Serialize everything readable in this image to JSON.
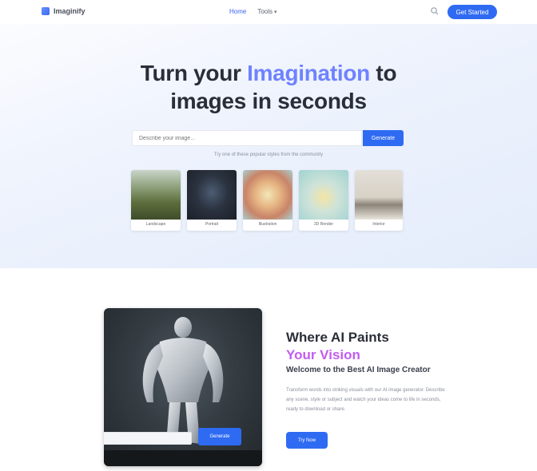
{
  "nav": {
    "logo_text": "Imaginify",
    "links": [
      {
        "label": "Home",
        "active": true
      },
      {
        "label": "Tools",
        "has_dropdown": true
      }
    ],
    "signup_label": "Get Started"
  },
  "hero": {
    "title_part1": "Turn your ",
    "title_accent": "Imagination",
    "title_part2": " to",
    "title_line2": "images in seconds",
    "prompt_placeholder": "Describe your image...",
    "generate_label": "Generate",
    "hint": "Try one of these popular styles from the community",
    "gallery": [
      {
        "label": "Landscape"
      },
      {
        "label": "Portrait"
      },
      {
        "label": "Illustration"
      },
      {
        "label": "3D Render"
      },
      {
        "label": "Interior"
      }
    ]
  },
  "feature": {
    "heading_line1": "Where AI Paints",
    "heading_line2": "Your Vision",
    "subheading": "Welcome to the Best AI Image Creator",
    "description": "Transform words into striking visuals with our AI image generator. Describe any scene, style or subject and watch your ideas come to life in seconds, ready to download or share.",
    "overlay_button_label": "Generate",
    "cta_label": "Try Now"
  },
  "colors": {
    "accent_blue": "#2f6bf2",
    "title_accent": "#6f82ff",
    "heading_purple": "#c25cf0"
  }
}
